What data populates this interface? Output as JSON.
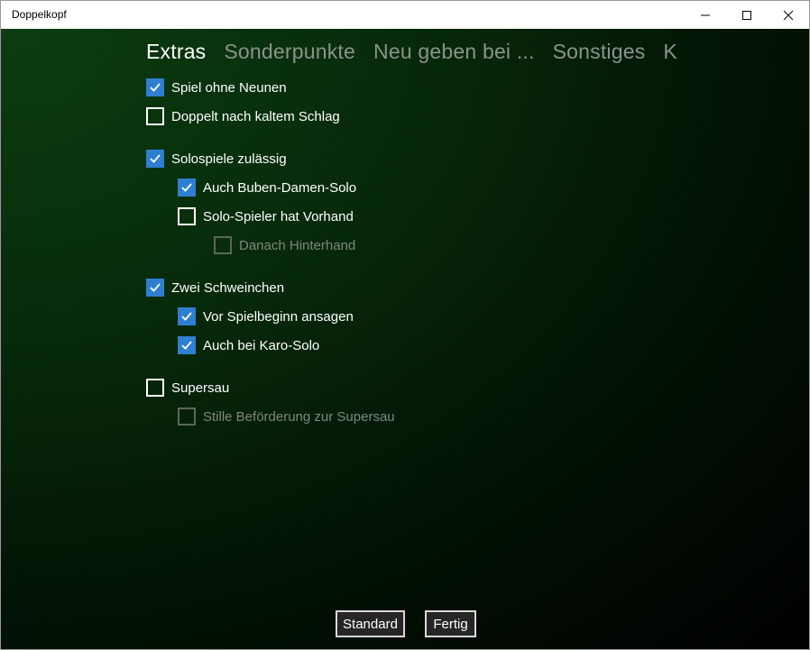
{
  "window": {
    "title": "Doppelkopf"
  },
  "tabs": [
    {
      "label": "Extras",
      "active": true
    },
    {
      "label": "Sonderpunkte",
      "active": false
    },
    {
      "label": "Neu geben bei ...",
      "active": false
    },
    {
      "label": "Sonstiges",
      "active": false
    },
    {
      "label": "K",
      "active": false
    }
  ],
  "options": [
    {
      "label": "Spiel ohne Neunen",
      "checked": true,
      "enabled": true
    },
    {
      "label": "Doppelt nach kaltem Schlag",
      "checked": false,
      "enabled": true
    },
    {
      "label": "Solospiele zulässig",
      "checked": true,
      "enabled": true
    },
    {
      "label": "Auch Buben-Damen-Solo",
      "checked": true,
      "enabled": true
    },
    {
      "label": "Solo-Spieler hat Vorhand",
      "checked": false,
      "enabled": true
    },
    {
      "label": "Danach Hinterhand",
      "checked": false,
      "enabled": false
    },
    {
      "label": "Zwei Schweinchen",
      "checked": true,
      "enabled": true
    },
    {
      "label": "Vor Spielbeginn ansagen",
      "checked": true,
      "enabled": true
    },
    {
      "label": "Auch bei Karo-Solo",
      "checked": true,
      "enabled": true
    },
    {
      "label": "Supersau",
      "checked": false,
      "enabled": true
    },
    {
      "label": "Stille Beförderung zur Supersau",
      "checked": false,
      "enabled": false
    }
  ],
  "buttons": {
    "standard": "Standard",
    "fertig": "Fertig"
  },
  "colors": {
    "checkbox_accent": "#2f7fd1",
    "background_start": "#0b3d10",
    "background_end": "#000000"
  },
  "icons": {
    "minimize": "minimize-icon",
    "maximize": "maximize-icon",
    "close": "close-icon",
    "check": "checkmark-icon"
  }
}
